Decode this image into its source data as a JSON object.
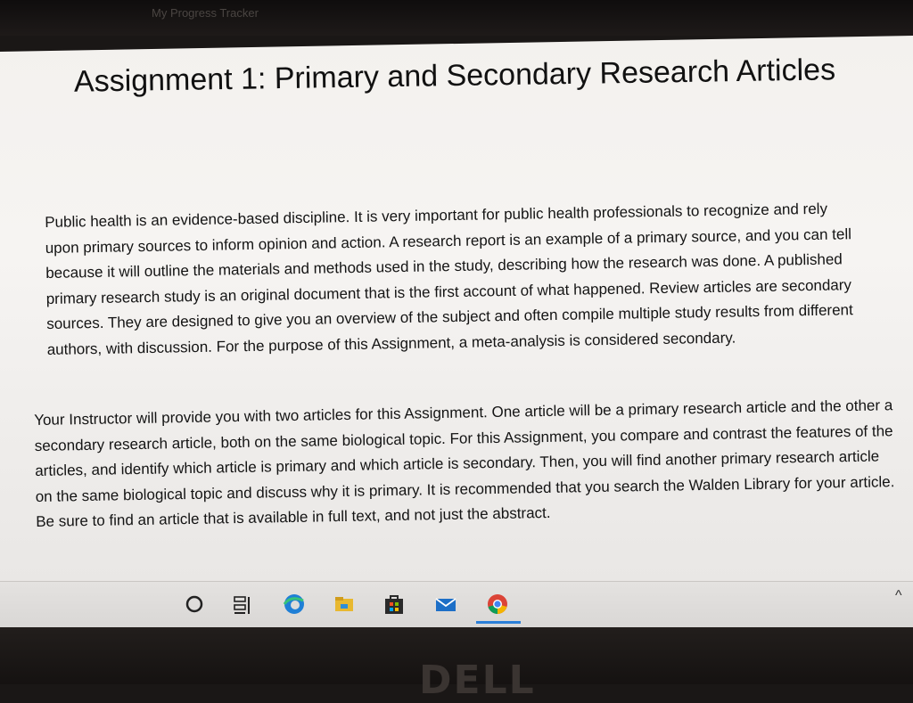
{
  "window": {
    "title": "My Progress Tracker"
  },
  "page": {
    "title": "Assignment 1: Primary and Secondary Research Articles",
    "paragraphs": [
      "Public health is an evidence-based discipline. It is very important for public health professionals to recognize and rely upon primary sources to inform opinion and action. A research report is an example of a primary source, and you can tell because it will outline the materials and methods used in the study, describing how the research was done. A published primary research study is an original document that is the first account of what happened. Review articles are secondary sources. They are designed to give you an overview of the subject and often compile multiple study results from different authors, with discussion. For the purpose of this Assignment, a meta-analysis is considered secondary.",
      "Your Instructor will provide you with two articles for this Assignment. One article will be a primary research article and the other a secondary research article, both on the same biological topic. For this Assignment, you compare and contrast the features of the articles, and identify which article is primary and which article is secondary. Then, you will find another primary research article on the same biological topic and discuss why it is primary. It is recommended that you search the Walden Library for your article. Be sure to find an article that is available in full text, and not just the abstract."
    ]
  },
  "taskbar": {
    "icons": [
      "search-circle-icon",
      "task-view-icon",
      "edge-browser-icon",
      "file-explorer-icon",
      "store-icon",
      "mail-icon",
      "chrome-icon"
    ],
    "tray_chevron": "^"
  },
  "hardware": {
    "logo": "DELL"
  },
  "colors": {
    "page_bg": "#f4f2f0",
    "text": "#141414",
    "taskbar_bg": "#dedcda",
    "active_indicator": "#2b7fd8",
    "bezel": "#1a1716"
  }
}
